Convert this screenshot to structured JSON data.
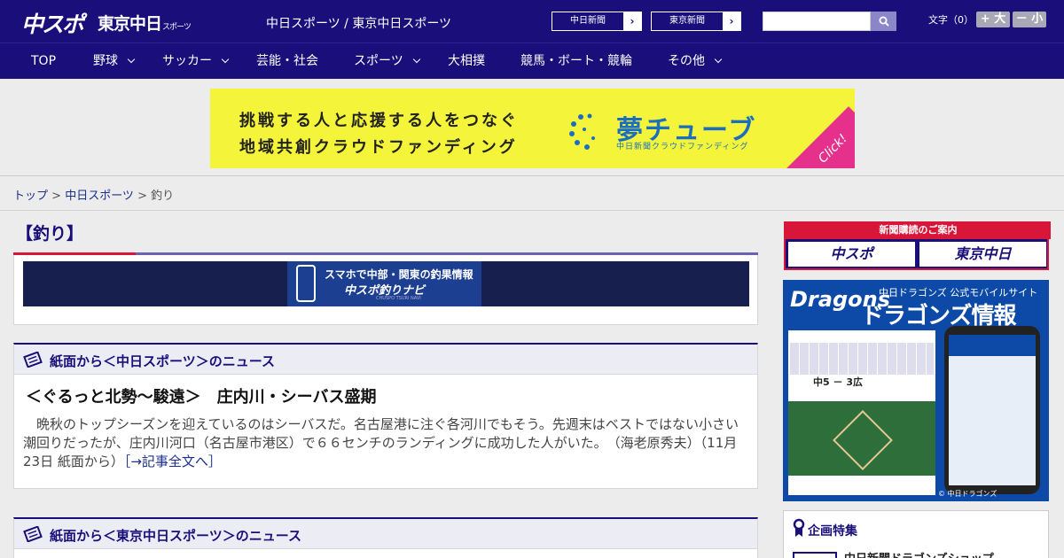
{
  "header": {
    "logo_chuspo": "中スポ",
    "logo_tokyo": "東京中日",
    "logo_tokyo_small": "スポーツ",
    "site_names": "中日スポーツ / 東京中日スポーツ",
    "paper_chunichi": "中日新聞",
    "paper_tokyo": "東京新聞",
    "search_placeholder": "",
    "fontsize_label": "文字（0）",
    "font_larger": "+ 大",
    "font_smaller": "－ 小"
  },
  "nav": {
    "items": [
      {
        "label": "TOP"
      },
      {
        "label": "野球"
      },
      {
        "label": "サッカー"
      },
      {
        "label": "芸能・社会"
      },
      {
        "label": "スポーツ"
      },
      {
        "label": "大相撲"
      },
      {
        "label": "競馬・ボート・競輪"
      },
      {
        "label": "その他"
      }
    ]
  },
  "ad": {
    "line1": "挑戦する人と応援する人をつなぐ",
    "line2": "地域共創クラウドファンディング",
    "brand": "夢チューブ",
    "sub": "中日新聞クラウドファンディング",
    "click": "Click!"
  },
  "breadcrumb": {
    "top": "トップ",
    "sep1": " > ",
    "parent": "中日スポーツ",
    "sep2": " > ",
    "current": "釣り"
  },
  "main": {
    "heading": "【釣り】",
    "navi_banner": {
      "line1": "スマホで中部・関東の釣果情報",
      "line2": "中スポ釣りナビ",
      "line3": "CHUSPO TSURI NAVI"
    },
    "sections": [
      {
        "title": "紙面から＜中日スポーツ＞のニュース",
        "article_title": "＜ぐるっと北勢～駿遠＞　庄内川・シーバス盛期",
        "article_body": "　晩秋のトップシーズンを迎えているのはシーバスだ。名古屋港に注ぐ各河川でもそう。先週末はベストではない小さい潮回りだったが、庄内川河口（名古屋市港区）で６６センチのランディングに成功した人がいた。　（海老原秀夫）（11月23日 紙面から）",
        "more": "［→記事全文へ］"
      },
      {
        "title": "紙面から＜東京中日スポーツ＞のニュース"
      }
    ]
  },
  "sidebar": {
    "subscribe_head": "新聞購読のご案内",
    "subscribe_chuspo": "中スポ",
    "subscribe_tokyo": "東京中日",
    "dragons": {
      "logo": "Dragons",
      "sub1": "中日ドラゴンズ 公式モバイルサイト",
      "sub2": "ドラゴンズ情報",
      "score": "中5 － 3広",
      "footer": "© 中日ドラゴンズ"
    },
    "plan_title": "企画特集",
    "plan_item": "中日新聞ドラゴンズショップ"
  }
}
